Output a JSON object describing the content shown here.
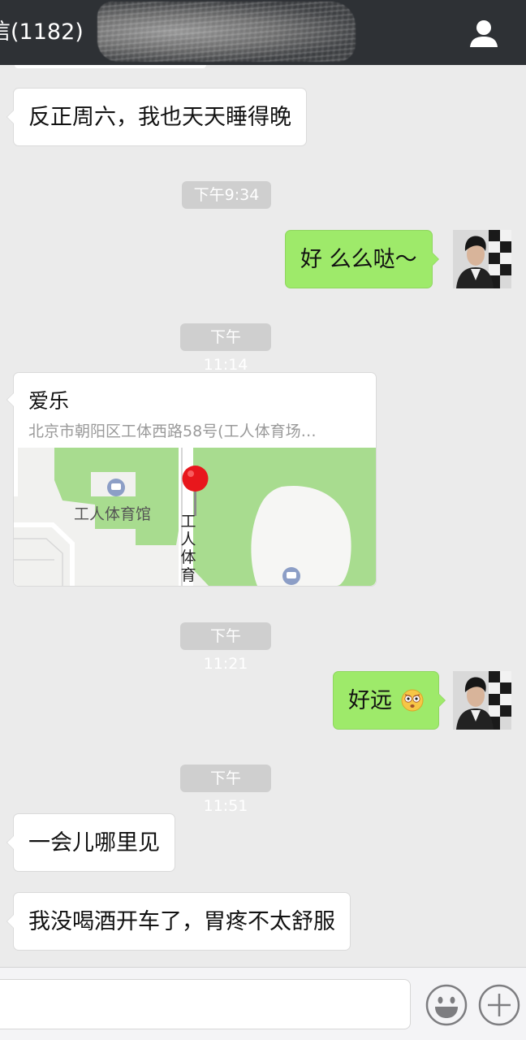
{
  "header": {
    "title": "信(1182)"
  },
  "messages": [
    {
      "kind": "in",
      "text": "反正周六，我也天天睡得晚"
    },
    {
      "kind": "time",
      "text": "下午9:34"
    },
    {
      "kind": "out",
      "text": "好 么么哒～"
    },
    {
      "kind": "time",
      "text": "下午11:14"
    },
    {
      "kind": "location",
      "title": "爱乐",
      "address": "北京市朝阳区工体西路58号(工人体育场…",
      "map_labels": {
        "venue": "工人体育馆",
        "road": "工人体育"
      }
    },
    {
      "kind": "time",
      "text": "下午11:21"
    },
    {
      "kind": "out",
      "text": "好远"
    },
    {
      "kind": "time",
      "text": "下午11:51"
    },
    {
      "kind": "in",
      "text": "一会儿哪里见"
    },
    {
      "kind": "in",
      "text": "我没喝酒开车了，胃疼不太舒服"
    }
  ],
  "icons": {
    "profile": "person-icon",
    "emoji_reaction": "shocked-face-icon",
    "emoji_button": "smiley-icon",
    "more_button": "plus-icon"
  },
  "input": {
    "value": "",
    "placeholder": ""
  },
  "colors": {
    "header_bg": "#2e3135",
    "chat_bg": "#ebebeb",
    "outgoing_bubble": "#9eea6a",
    "incoming_bubble": "#ffffff",
    "timestamp_bg": "#cfcfcf",
    "map_green": "#a8dc8f",
    "map_pin": "#e8171c"
  }
}
